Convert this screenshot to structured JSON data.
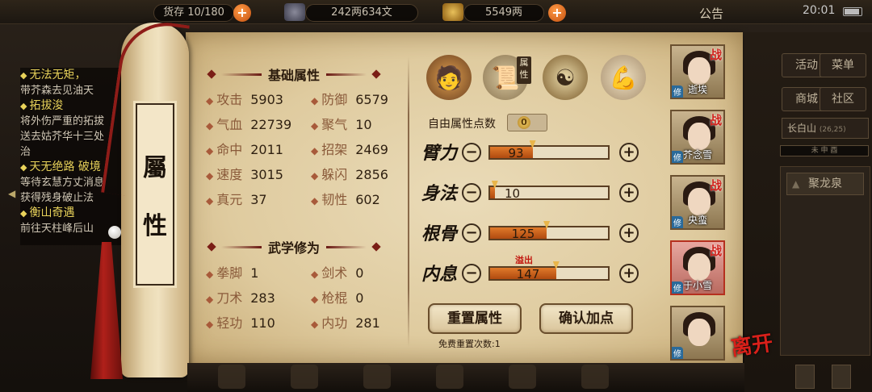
{
  "top": {
    "capacity": "货存 10/180",
    "money": "242两634文",
    "gold": "5549两",
    "notice": "公告",
    "clock": "20:01"
  },
  "quests": [
    {
      "title": "无法无矩，",
      "desc": [
        "带芥森去见油天"
      ]
    },
    {
      "title": "拓拔浚",
      "desc": [
        "将外伤严重的拓拔",
        "送去姑芥华十三处",
        "治"
      ]
    },
    {
      "title": "天无绝路 破境",
      "desc": [
        "等待玄慧方丈消息",
        "获得残身破止法"
      ]
    },
    {
      "title": "衡山奇遇",
      "desc": [
        "前往天柱峰后山"
      ]
    }
  ],
  "tab": {
    "char1": "屬",
    "char2": "性"
  },
  "basic": {
    "title": "基础属性",
    "stats": [
      {
        "name": "攻击",
        "value": "5903"
      },
      {
        "name": "防御",
        "value": "6579"
      },
      {
        "name": "气血",
        "value": "22739"
      },
      {
        "name": "聚气",
        "value": "10"
      },
      {
        "name": "命中",
        "value": "2011"
      },
      {
        "name": "招架",
        "value": "2469"
      },
      {
        "name": "速度",
        "value": "3015"
      },
      {
        "name": "躲闪",
        "value": "2856"
      },
      {
        "name": "真元",
        "value": "37"
      },
      {
        "name": "韧性",
        "value": "602"
      }
    ]
  },
  "martial": {
    "title": "武学修为",
    "stats": [
      {
        "name": "拳脚",
        "value": "1"
      },
      {
        "name": "剑术",
        "value": "0"
      },
      {
        "name": "刀术",
        "value": "283"
      },
      {
        "name": "枪棍",
        "value": "0"
      },
      {
        "name": "轻功",
        "value": "110"
      },
      {
        "name": "内功",
        "value": "281"
      }
    ]
  },
  "attr_tag": "属性",
  "free_points": {
    "label": "自由属性点数",
    "value": "0"
  },
  "attributes": [
    {
      "name": "臂力",
      "value": "93",
      "fill": 0.36
    },
    {
      "name": "身法",
      "value": "10",
      "fill": 0.04
    },
    {
      "name": "根骨",
      "value": "125",
      "fill": 0.48
    },
    {
      "name": "内息",
      "value": "147",
      "fill": 0.56
    }
  ],
  "overflow_label": "溢出",
  "buttons": {
    "reset": "重置属性",
    "confirm": "确认加点"
  },
  "reset_note": "免费重置次数:1",
  "characters": [
    {
      "name": "逝埃",
      "battle": "战",
      "lv": "修"
    },
    {
      "name": "芥念雪",
      "battle": "战",
      "lv": "修"
    },
    {
      "name": "央蛮",
      "battle": "战",
      "lv": "修"
    },
    {
      "name": "于小雪",
      "battle": "战",
      "lv": "修"
    },
    {
      "name": "",
      "battle": "",
      "lv": "修"
    }
  ],
  "leave": "离开",
  "menu": {
    "activity": "活动",
    "menu": "菜单",
    "shop": "商城",
    "community": "社区",
    "location": "长白山",
    "coords": "(26,25)",
    "time": "未  申  酉",
    "spot": "聚龙泉"
  }
}
